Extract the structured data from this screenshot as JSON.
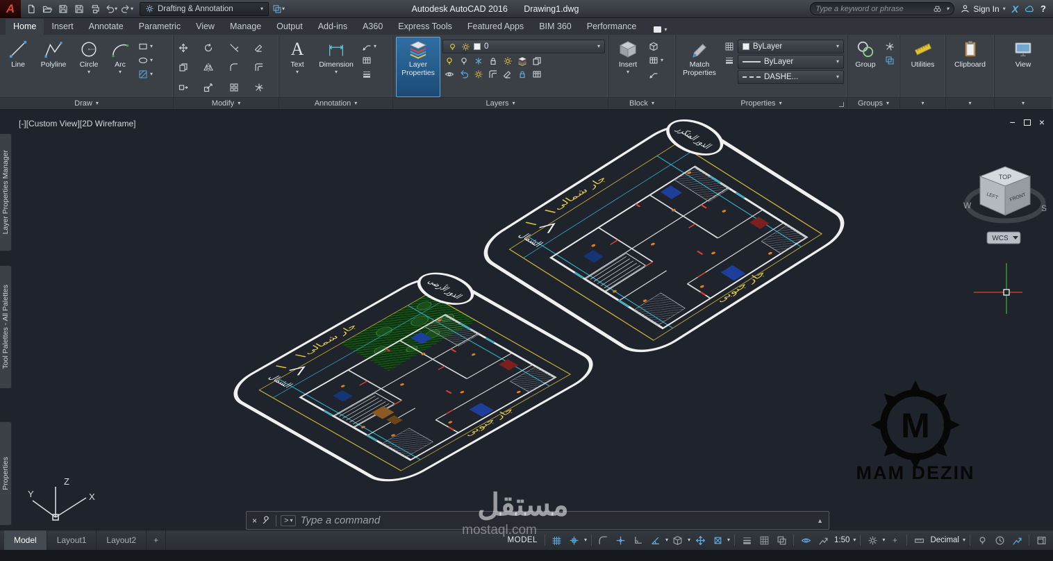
{
  "icons": {
    "caret": "▾",
    "caret_up": "▲",
    "close": "×",
    "minimize": "−",
    "help": "?",
    "plus": "+",
    "prompt_arrow": ">",
    "text_tool_glyph": "A"
  },
  "titlebar": {
    "workspace": "Drafting & Annotation",
    "app_title": "Autodesk AutoCAD 2016",
    "doc_title": "Drawing1.dwg",
    "search_placeholder": "Type a keyword or phrase",
    "signin_label": "Sign In",
    "exchange_label": "X"
  },
  "ribbon_tabs": {
    "items": [
      "Home",
      "Insert",
      "Annotate",
      "Parametric",
      "View",
      "Manage",
      "Output",
      "Add-ins",
      "A360",
      "Express Tools",
      "Featured Apps",
      "BIM 360",
      "Performance"
    ]
  },
  "ribbon": {
    "draw": {
      "label": "Draw",
      "line": "Line",
      "polyline": "Polyline",
      "circle": "Circle",
      "arc": "Arc"
    },
    "modify": {
      "label": "Modify"
    },
    "annotation": {
      "label": "Annotation",
      "text": "Text",
      "dimension": "Dimension"
    },
    "layers": {
      "label": "Layers",
      "layer_properties": "Layer Properties",
      "current_layer": "0"
    },
    "block": {
      "label": "Block",
      "insert": "Insert"
    },
    "properties": {
      "label": "Properties",
      "match_properties": "Match Properties",
      "color": "ByLayer",
      "lineweight": "ByLayer",
      "linetype": "DASHE..."
    },
    "groups": {
      "label": "Groups",
      "group": "Group"
    },
    "utilities": {
      "label": "Utilities"
    },
    "clipboard": {
      "label": "Clipboard"
    },
    "view": {
      "label": "View"
    }
  },
  "canvas": {
    "viewport_controls": "[-][Custom View][2D Wireframe]",
    "sidebar_tabs": [
      "Layer Properties Manager",
      "Tool Palettes - All Palettes",
      "Properties"
    ],
    "viewcube": {
      "top": "TOP",
      "front": "FRONT",
      "left": "LEFT",
      "west": "W",
      "south": "S",
      "wcs": "WCS"
    },
    "ucs": {
      "x": "X",
      "y": "Y",
      "z": "Z"
    },
    "logo_text": "MAM DEZIN",
    "watermark_arabic": "مستقل",
    "watermark_latin": "mostaql.com",
    "plan_upper": {
      "badge": "الدور المتكرر",
      "north_neighbor": "جار شمالى",
      "south_neighbor": "جار جنوبى",
      "north": "الشمال"
    },
    "plan_lower": {
      "badge": "الدور الأرضى",
      "north_neighbor": "جار شمالى",
      "south_neighbor": "جار جنوبى",
      "north": "الشمال"
    }
  },
  "command_line": {
    "prompt": "Type a command"
  },
  "statusbar": {
    "layout_tabs": [
      "Model",
      "Layout1",
      "Layout2"
    ],
    "model_label": "MODEL",
    "annotation_scale": "1:50",
    "units": "Decimal"
  }
}
